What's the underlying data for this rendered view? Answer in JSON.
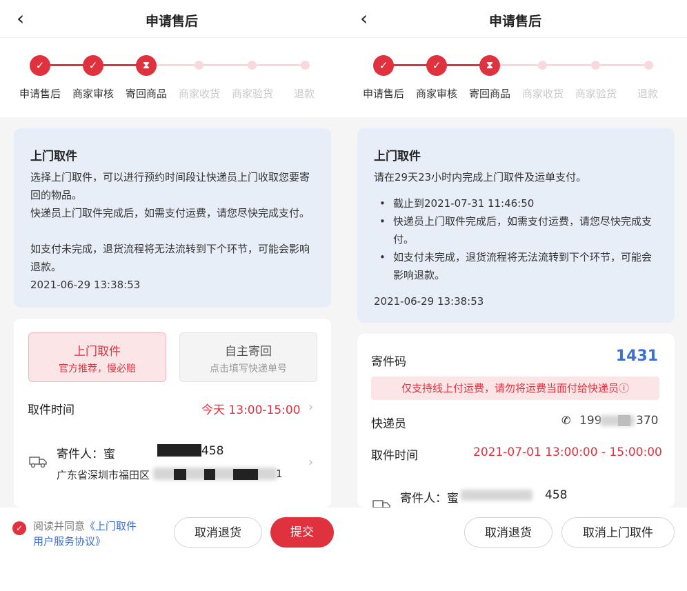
{
  "left": {
    "header": {
      "back_icon": "‹",
      "title": "申请售后"
    },
    "steps": [
      {
        "label": "申请售后",
        "state": "done"
      },
      {
        "label": "商家审核",
        "state": "done"
      },
      {
        "label": "寄回商品",
        "state": "current"
      },
      {
        "label": "商家收货",
        "state": "pending"
      },
      {
        "label": "商家验货",
        "state": "pending"
      },
      {
        "label": "退款",
        "state": "pending"
      }
    ],
    "notice": {
      "title": "上门取件",
      "p1": "选择上门取件，可以进行预约时间段让快递员上门收取您要寄回的物品。",
      "p2": "快递员上门取件完成后，如需支付运费，请您尽快完成支付。",
      "p3": "如支付未完成，退货流程将无法流转到下个环节，可能会影响退款。",
      "timestamp": "2021-06-29 13:38:53"
    },
    "options": {
      "pickup": {
        "title": "上门取件",
        "subtitle": "官方推荐，慢必赔"
      },
      "self": {
        "title": "自主寄回",
        "subtitle": "点击填写快递单号"
      }
    },
    "pickup_time": {
      "label": "取件时间",
      "value": "今天 13:00-15:00"
    },
    "sender": {
      "name_prefix": "寄件人：蜜",
      "name_suffix": "458",
      "address_prefix": "广东省深圳市福田区",
      "address_suffix": "1"
    },
    "footer": {
      "agree_prefix": "阅读并同意",
      "agree_link_1": "《上门取件",
      "agree_link_2": "用户服务协议》",
      "cancel_label": "取消退货",
      "submit_label": "提交"
    }
  },
  "right": {
    "header": {
      "back_icon": "‹",
      "title": "申请售后"
    },
    "steps": [
      {
        "label": "申请售后",
        "state": "done"
      },
      {
        "label": "商家审核",
        "state": "done"
      },
      {
        "label": "寄回商品",
        "state": "current"
      },
      {
        "label": "商家收货",
        "state": "pending"
      },
      {
        "label": "商家验货",
        "state": "pending"
      },
      {
        "label": "退款",
        "state": "pending"
      }
    ],
    "notice": {
      "title": "上门取件",
      "intro": "请在29天23小时内完成上门取件及运单支付。",
      "bullets": [
        "截止到2021-07-31 11:46:50",
        "快递员上门取件完成后，如需支付运费，请您尽快完成支付。",
        "如支付未完成，退货流程将无法流转到下个环节，可能会影响退款。"
      ],
      "timestamp": "2021-06-29 13:38:53"
    },
    "code": {
      "label": "寄件码",
      "value": "1431"
    },
    "warning": "仅支持线上付运费，请勿将运费当面付给快递员ⓘ",
    "courier": {
      "label": "快递员",
      "phone_prefix": "199",
      "phone_suffix": "370"
    },
    "pickup_time": {
      "label": "取件时间",
      "value": "2021-07-01 13:00:00 - 15:00:00"
    },
    "sender": {
      "name_prefix": "寄件人：蜜",
      "name_suffix": "458"
    },
    "footer": {
      "cancel_return_label": "取消退货",
      "cancel_pickup_label": "取消上门取件"
    }
  },
  "colors": {
    "accent": "#e0313f",
    "notice_bg": "#e7eef8",
    "link": "#3b6fd6"
  }
}
